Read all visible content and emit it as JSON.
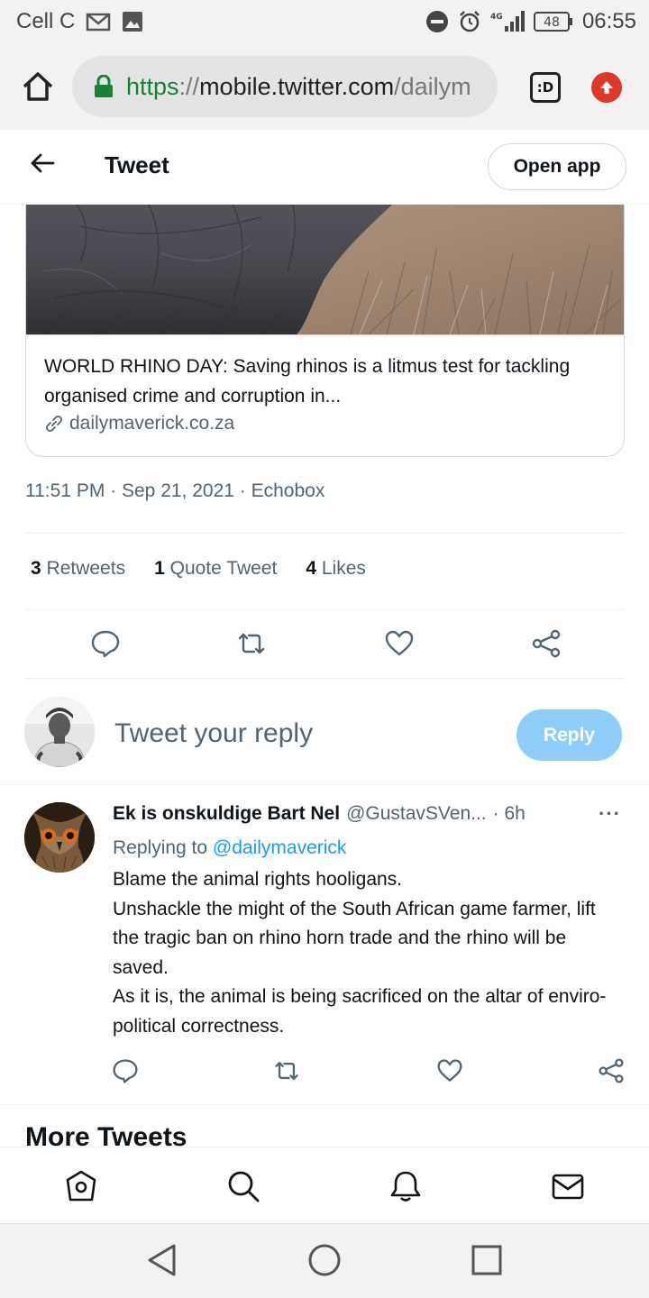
{
  "status_bar": {
    "carrier": "Cell C",
    "battery": "48",
    "time": "06:55",
    "network": "4G"
  },
  "browser": {
    "url_scheme": "https",
    "url_separator": "://",
    "url_host": "mobile.twitter.com",
    "url_path": "/dailym",
    "tab_label": ":D",
    "icons": [
      "home-icon",
      "lock-icon",
      "tab-switcher-icon",
      "update-icon"
    ]
  },
  "header": {
    "title": "Tweet",
    "open_app_label": "Open app"
  },
  "card": {
    "title": "WORLD RHINO DAY: Saving rhinos is a litmus test for tackling organised crime and corruption in...",
    "domain": "dailymaverick.co.za"
  },
  "tweet": {
    "meta": "11:51 PM · Sep 21, 2021 · Echobox",
    "retweets_count": "3",
    "retweets_label": "Retweets",
    "quotes_count": "1",
    "quotes_label": "Quote Tweet",
    "likes_count": "4",
    "likes_label": "Likes"
  },
  "composer": {
    "placeholder": "Tweet your reply",
    "reply_label": "Reply"
  },
  "reply": {
    "name": "Ek is onskuldige Bart Nel",
    "handle": "@GustavSVen...",
    "time": "· 6h",
    "more": "···",
    "replying_prefix": "Replying to",
    "replying_to": "@dailymaverick",
    "lines": [
      "Blame the animal rights hooligans.",
      "Unshackle the might of the South African game farmer, lift the tragic ban on rhino horn trade and the rhino will be saved.",
      "As it is, the animal is being sacrificed on the altar of enviro-political correctness."
    ]
  },
  "section": {
    "more_tweets": "More Tweets"
  },
  "colors": {
    "accent": "#1d9bf0",
    "reply_button": "#8ecdf8",
    "secure_green": "#188038",
    "muted": "#536471"
  }
}
